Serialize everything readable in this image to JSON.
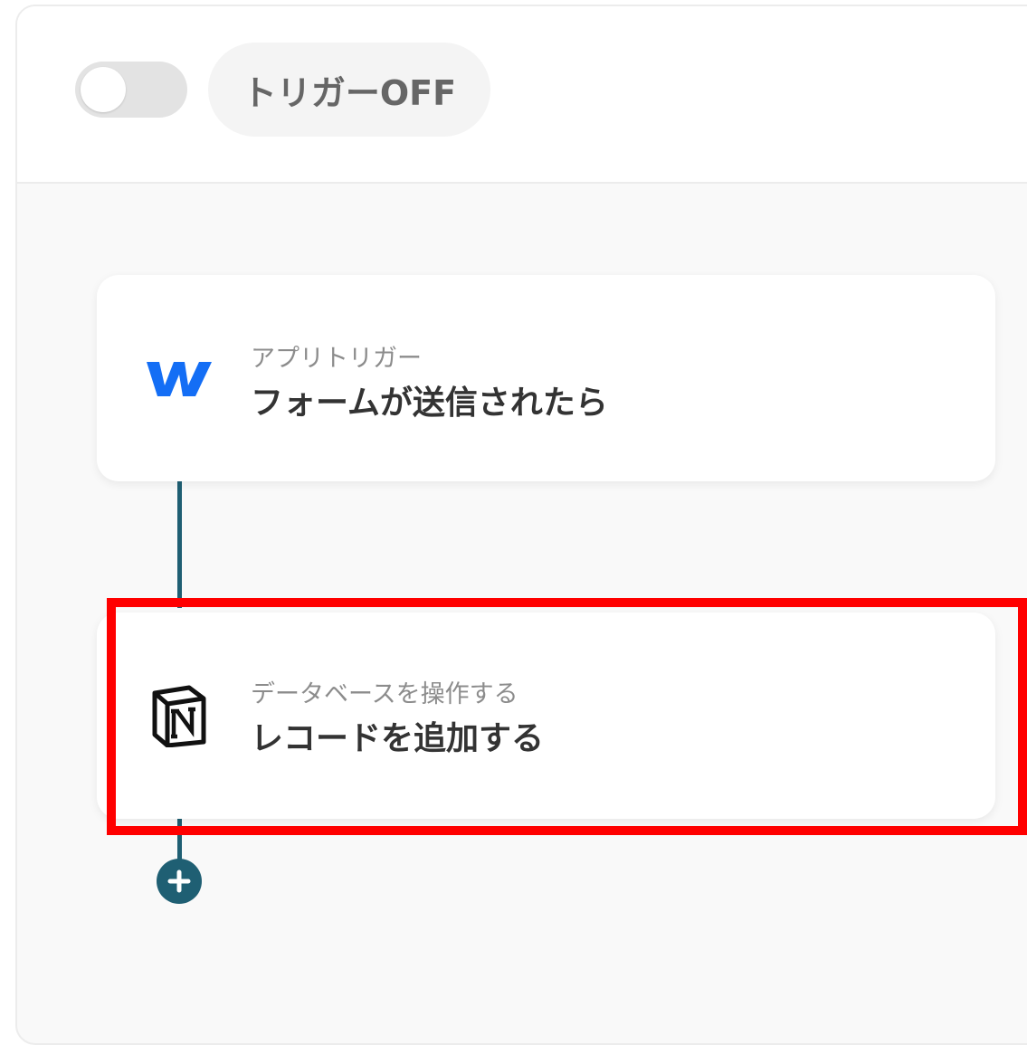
{
  "topbar": {
    "trigger_toggle_state": "off",
    "trigger_status_label": "トリガーOFF"
  },
  "flow": {
    "steps": [
      {
        "app_icon": "webflow-icon",
        "subtitle": "アプリトリガー",
        "title": "フォームが送信されたら"
      },
      {
        "app_icon": "notion-icon",
        "subtitle": "データベースを操作する",
        "title": "レコードを追加する"
      }
    ],
    "add_step_icon": "plus-icon"
  },
  "colors": {
    "accent": "#1f5f73",
    "webflow_blue": "#146ef5",
    "highlight_red": "#ff0000",
    "toggle_off": "#e3e3e3"
  }
}
